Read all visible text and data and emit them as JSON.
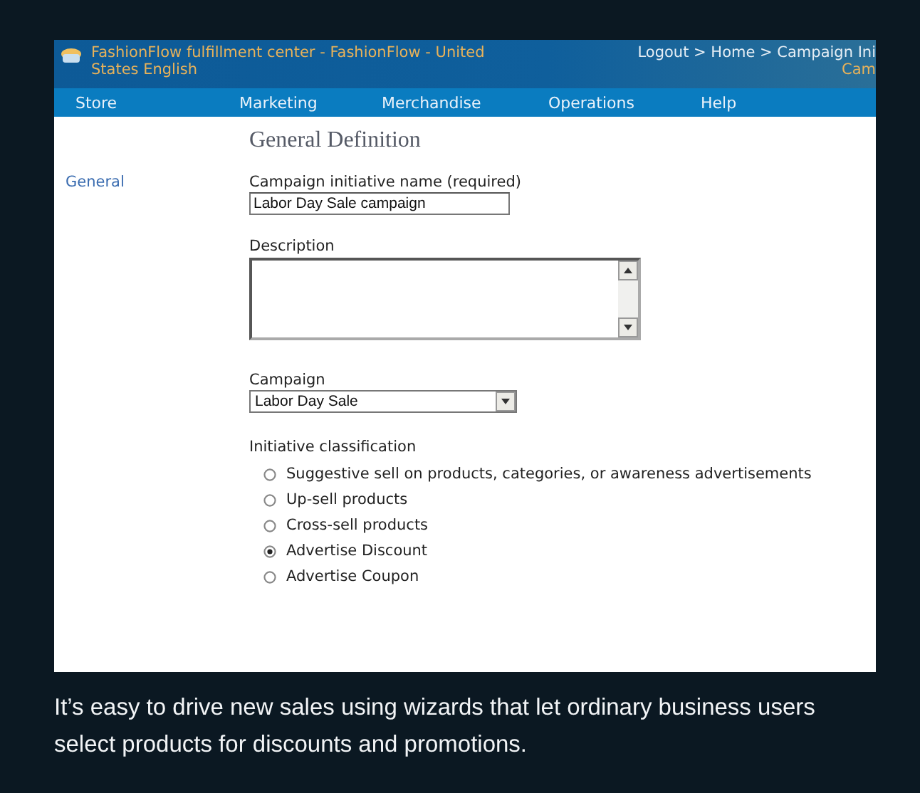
{
  "header": {
    "title": "FashionFlow fulfillment center - FashionFlow - United States English",
    "breadcrumb": "Logout > Home > Campaign Ini",
    "breadcrumb_sub": "Cam"
  },
  "nav": [
    {
      "label": "Store"
    },
    {
      "label": "Marketing"
    },
    {
      "label": "Merchandise"
    },
    {
      "label": "Operations"
    },
    {
      "label": "Help"
    }
  ],
  "sidebar": {
    "items": [
      {
        "label": "General"
      }
    ]
  },
  "form": {
    "heading": "General Definition",
    "name_label": "Campaign initiative name (required)",
    "name_value": "Labor Day Sale campaign",
    "description_label": "Description",
    "campaign_label": "Campaign",
    "campaign_value": "Labor Day Sale",
    "classification_label": "Initiative classification",
    "options": [
      {
        "label": "Suggestive sell on products, categories, or awareness advertisements",
        "selected": false
      },
      {
        "label": "Up-sell products",
        "selected": false
      },
      {
        "label": "Cross-sell products",
        "selected": false
      },
      {
        "label": "Advertise Discount",
        "selected": true
      },
      {
        "label": "Advertise Coupon",
        "selected": false
      }
    ]
  },
  "caption": "It’s easy to drive new sales using wizards that let ordinary business users select products for discounts and promotions."
}
